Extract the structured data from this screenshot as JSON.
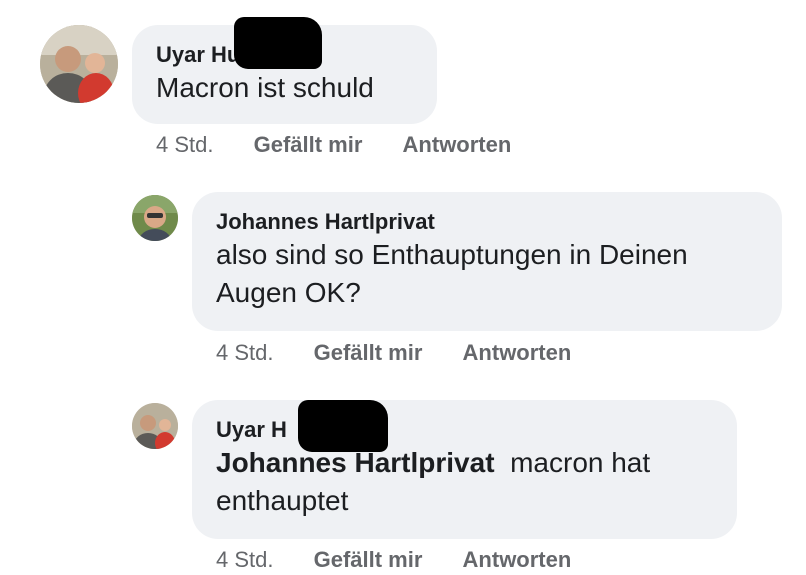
{
  "comments": [
    {
      "author": "Uyar Hu",
      "text": "Macron ist schuld",
      "time": "4 Std.",
      "like_label": "Gefällt mir",
      "reply_label": "Antworten"
    },
    {
      "author": "Johannes Hartlprivat",
      "text": "also sind so Enthauptungen in Deinen Augen OK?",
      "time": "4 Std.",
      "like_label": "Gefällt mir",
      "reply_label": "Antworten"
    },
    {
      "author": "Uyar H",
      "mention": "Johannes Hartlprivat",
      "text": "macron hat enthauptet",
      "time": "4 Std.",
      "like_label": "Gefällt mir",
      "reply_label": "Antworten"
    }
  ]
}
